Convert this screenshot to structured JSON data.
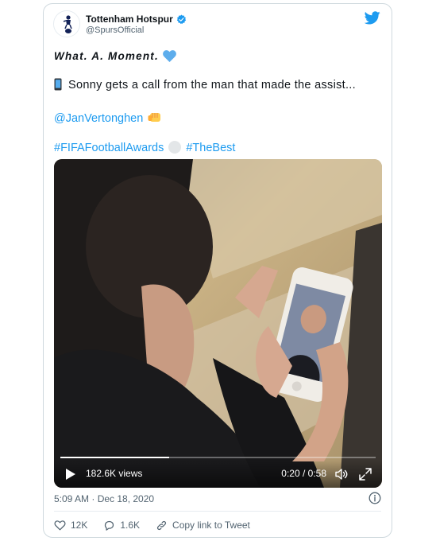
{
  "author": {
    "name": "Tottenham Hotspur",
    "handle": "@SpursOfficial",
    "verified": true,
    "avatar_icon": "cockerel-crest-icon"
  },
  "tweet": {
    "headline": "What. A. Moment.",
    "line2": "Sonny gets a call from the man that made the assist...",
    "mention": "@JanVertonghen",
    "hashtag1": "#FIFAFootballAwards",
    "hashtag2": "#TheBest"
  },
  "video": {
    "views": "182.6K views",
    "time": "0:20 / 0:58",
    "progress": 0.345
  },
  "timestamp": "5:09 AM · Dec 18, 2020",
  "actions": {
    "likes": "12K",
    "replies": "1.6K",
    "copy_link": "Copy link to Tweet"
  },
  "colors": {
    "accent": "#1d9bf0",
    "text": "#0f1419",
    "muted": "#536471",
    "heart": "#5dadec"
  }
}
